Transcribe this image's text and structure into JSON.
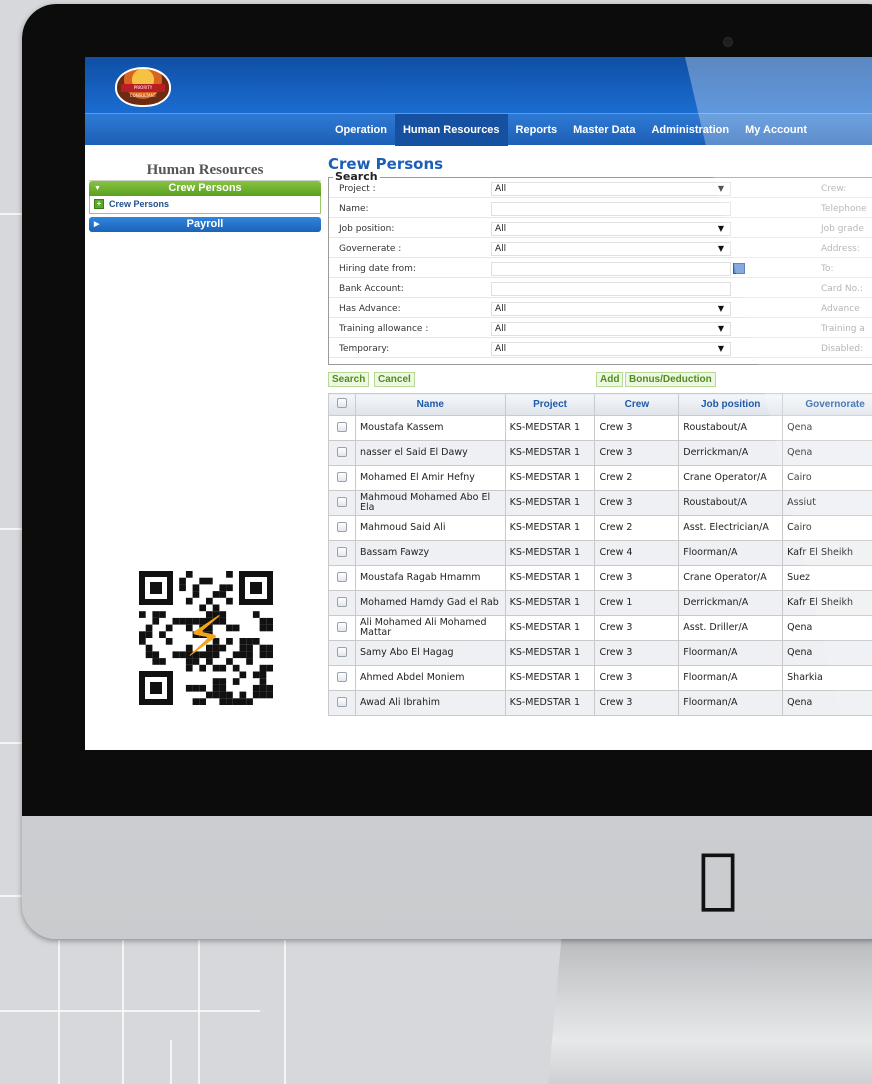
{
  "brand": {
    "logo_text": "PRIORITY CONSULTANT"
  },
  "nav": {
    "items": [
      {
        "label": "Operation"
      },
      {
        "label": "Human Resources",
        "active": true
      },
      {
        "label": "Reports"
      },
      {
        "label": "Master Data"
      },
      {
        "label": "Administration"
      },
      {
        "label": "My Account"
      }
    ]
  },
  "sidebar": {
    "title": "Human Resources",
    "sections": [
      {
        "label": "Crew Persons",
        "expanded": true,
        "items": [
          {
            "label": "Crew Persons",
            "icon": "plus-icon"
          }
        ]
      },
      {
        "label": "Payroll",
        "expanded": false,
        "items": []
      }
    ]
  },
  "page": {
    "title": "Crew Persons",
    "search": {
      "legend": "Search",
      "rows": [
        {
          "label": "Project :",
          "type": "select",
          "value": "All",
          "right_label": "Crew:"
        },
        {
          "label": "Name:",
          "type": "input",
          "value": "",
          "right_label": "Telephone"
        },
        {
          "label": "Job position:",
          "type": "select",
          "value": "All",
          "right_label": "Job grade"
        },
        {
          "label": "Governerate :",
          "type": "select",
          "value": "All",
          "right_label": "Address:"
        },
        {
          "label": "Hiring date from:",
          "type": "date",
          "value": "",
          "right_label": "To:"
        },
        {
          "label": "Bank Account:",
          "type": "input",
          "value": "",
          "right_label": "Card No.:"
        },
        {
          "label": "Has Advance:",
          "type": "select",
          "value": "All",
          "right_label": "Advance"
        },
        {
          "label": "Training allowance :",
          "type": "select",
          "value": "All",
          "right_label": "Training a"
        },
        {
          "label": "Temporary:",
          "type": "select",
          "value": "All",
          "right_label": "Disabled:"
        }
      ]
    },
    "actions": {
      "search": "Search",
      "cancel": "Cancel",
      "add": "Add",
      "bonus": "Bonus/Deduction"
    },
    "table": {
      "columns": [
        "Name",
        "Project",
        "Crew",
        "Job position",
        "Governorate"
      ],
      "rows": [
        {
          "name": "Moustafa Kassem",
          "project": "KS-MEDSTAR 1",
          "crew": "Crew 3",
          "job": "Roustabout/A",
          "gov": "Qena"
        },
        {
          "name": "nasser el Said El Dawy",
          "project": "KS-MEDSTAR 1",
          "crew": "Crew 3",
          "job": "Derrickman/A",
          "gov": "Qena"
        },
        {
          "name": "Mohamed El Amir Hefny",
          "project": "KS-MEDSTAR 1",
          "crew": "Crew 2",
          "job": "Crane Operator/A",
          "gov": "Cairo"
        },
        {
          "name": "Mahmoud Mohamed Abo El Ela",
          "project": "KS-MEDSTAR 1",
          "crew": "Crew 3",
          "job": "Roustabout/A",
          "gov": "Assiut"
        },
        {
          "name": "Mahmoud Said Ali",
          "project": "KS-MEDSTAR 1",
          "crew": "Crew 2",
          "job": "Asst. Electrician/A",
          "gov": "Cairo"
        },
        {
          "name": "Bassam Fawzy",
          "project": "KS-MEDSTAR 1",
          "crew": "Crew 4",
          "job": "Floorman/A",
          "gov": "Kafr El Sheikh"
        },
        {
          "name": "Moustafa Ragab Hmamm",
          "project": "KS-MEDSTAR 1",
          "crew": "Crew 3",
          "job": "Crane Operator/A",
          "gov": "Suez"
        },
        {
          "name": "Mohamed Hamdy Gad el Rab",
          "project": "KS-MEDSTAR 1",
          "crew": "Crew 1",
          "job": "Derrickman/A",
          "gov": "Kafr El Sheikh"
        },
        {
          "name": "Ali Mohamed Ali Mohamed Mattar",
          "project": "KS-MEDSTAR 1",
          "crew": "Crew 3",
          "job": "Asst. Driller/A",
          "gov": "Qena"
        },
        {
          "name": "Samy Abo El Hagag",
          "project": "KS-MEDSTAR 1",
          "crew": "Crew 3",
          "job": "Floorman/A",
          "gov": "Qena"
        },
        {
          "name": "Ahmed Abdel Moniem",
          "project": "KS-MEDSTAR 1",
          "crew": "Crew 3",
          "job": "Floorman/A",
          "gov": "Sharkia"
        },
        {
          "name": "Awad Ali Ibrahim",
          "project": "KS-MEDSTAR 1",
          "crew": "Crew 3",
          "job": "Floorman/A",
          "gov": "Qena"
        }
      ]
    }
  },
  "colors": {
    "header_blue": "#1b6cd1",
    "accent_green": "#5a9f22",
    "title_blue": "#1b5fb8"
  }
}
